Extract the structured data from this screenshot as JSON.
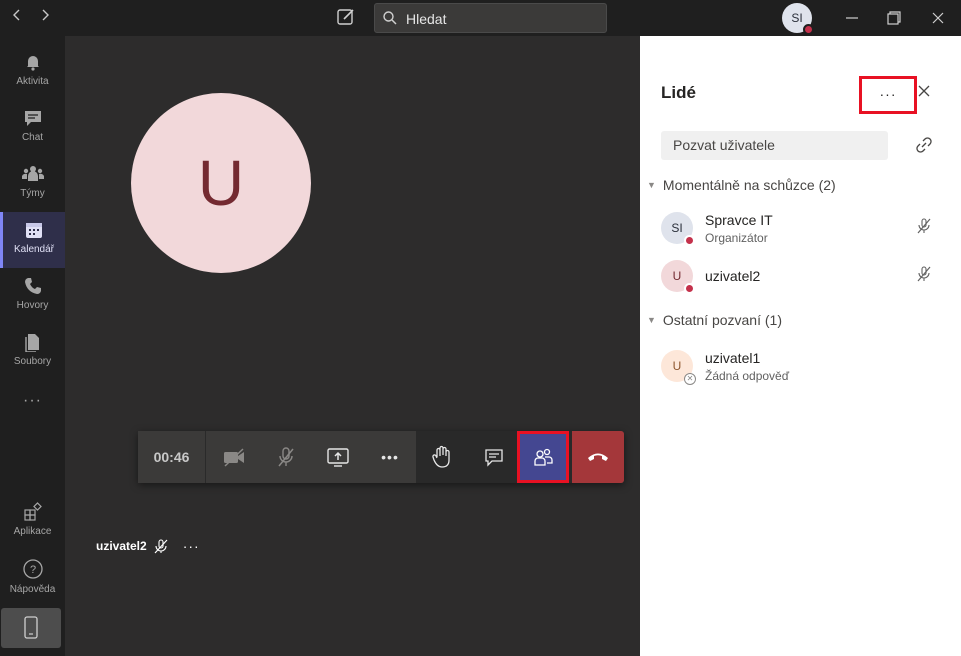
{
  "topbar": {
    "search_placeholder": "Hledat",
    "user_initials": "SI"
  },
  "rail": {
    "items": [
      {
        "label": "Aktivita",
        "icon": "bell-icon"
      },
      {
        "label": "Chat",
        "icon": "chat-icon"
      },
      {
        "label": "Týmy",
        "icon": "teams-icon"
      },
      {
        "label": "Kalendář",
        "icon": "calendar-icon",
        "active": true
      },
      {
        "label": "Hovory",
        "icon": "phone-icon"
      },
      {
        "label": "Soubory",
        "icon": "files-icon"
      },
      {
        "label": "Aplikace",
        "icon": "apps-icon"
      },
      {
        "label": "Nápověda",
        "icon": "help-icon"
      }
    ],
    "more": "···"
  },
  "stage": {
    "avatar_letter": "U",
    "timer": "00:46",
    "caller_name": "uzivatel2",
    "caller_more": "···",
    "more_actions": "•••"
  },
  "panel": {
    "title": "Lidé",
    "more": "···",
    "invite_placeholder": "Pozvat uživatele",
    "section_current": "Momentálně na schůzce (2)",
    "section_others": "Ostatní pozvaní (1)",
    "people_current": [
      {
        "initials": "SI",
        "name": "Spravce IT",
        "role": "Organizátor"
      },
      {
        "initials": "U",
        "name": "uzivatel2",
        "role": ""
      }
    ],
    "people_others": [
      {
        "initials": "U",
        "name": "uzivatel1",
        "role": "Žádná odpověď"
      }
    ]
  },
  "colors": {
    "accent": "#444791",
    "hangup": "#a4373a",
    "highlight": "#e81123",
    "status_busy": "#c4314b"
  }
}
